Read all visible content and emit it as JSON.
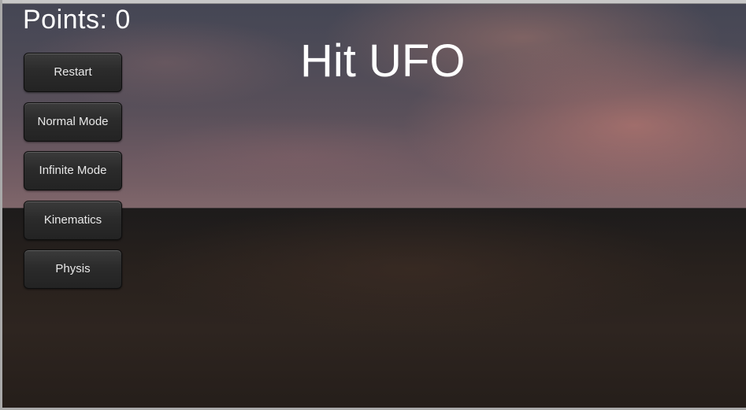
{
  "hud": {
    "points_label": "Points: 0",
    "title": "Hit UFO"
  },
  "menu": {
    "buttons": [
      {
        "label": "Restart"
      },
      {
        "label": "Normal Mode"
      },
      {
        "label": "Infinite Mode"
      },
      {
        "label": "Kinematics"
      },
      {
        "label": "Physis"
      }
    ]
  },
  "colors": {
    "hud_text": "#ffffff",
    "button_bg": "#2b2b2b",
    "button_text": "#e8e8e8",
    "sky_top": "#444654",
    "sky_horizon": "#7d6468",
    "ground": "#28211d"
  }
}
